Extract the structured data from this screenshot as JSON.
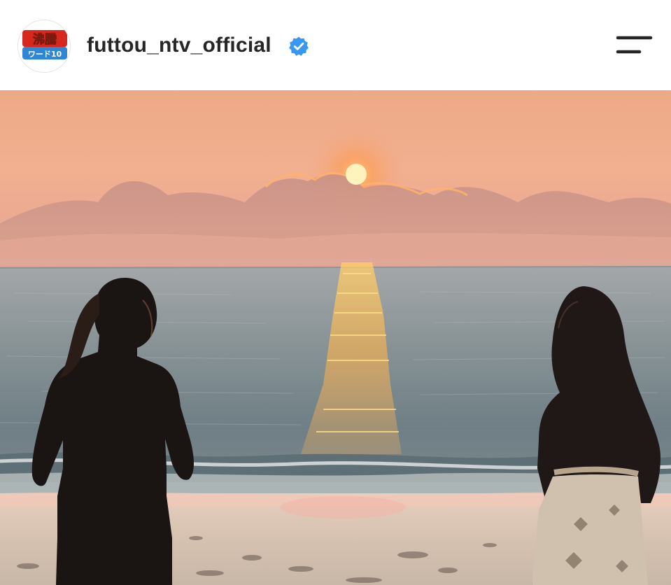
{
  "post": {
    "username": "futtou_ntv_official",
    "verified": true,
    "avatar_text_top": "沸騰",
    "avatar_text_bottom": "ワード10",
    "menu_icon": "hamburger-menu-icon",
    "verified_icon": "verified-badge-icon",
    "image": {
      "description_icon": "photo",
      "colors": {
        "sky_top": "#e9a985",
        "sky_horizon": "#f2b08f",
        "sun": "#fff2b8",
        "sea": "#7f8d92",
        "sand": "#d9c7b7",
        "accent_blue": "#3897f0"
      }
    }
  }
}
